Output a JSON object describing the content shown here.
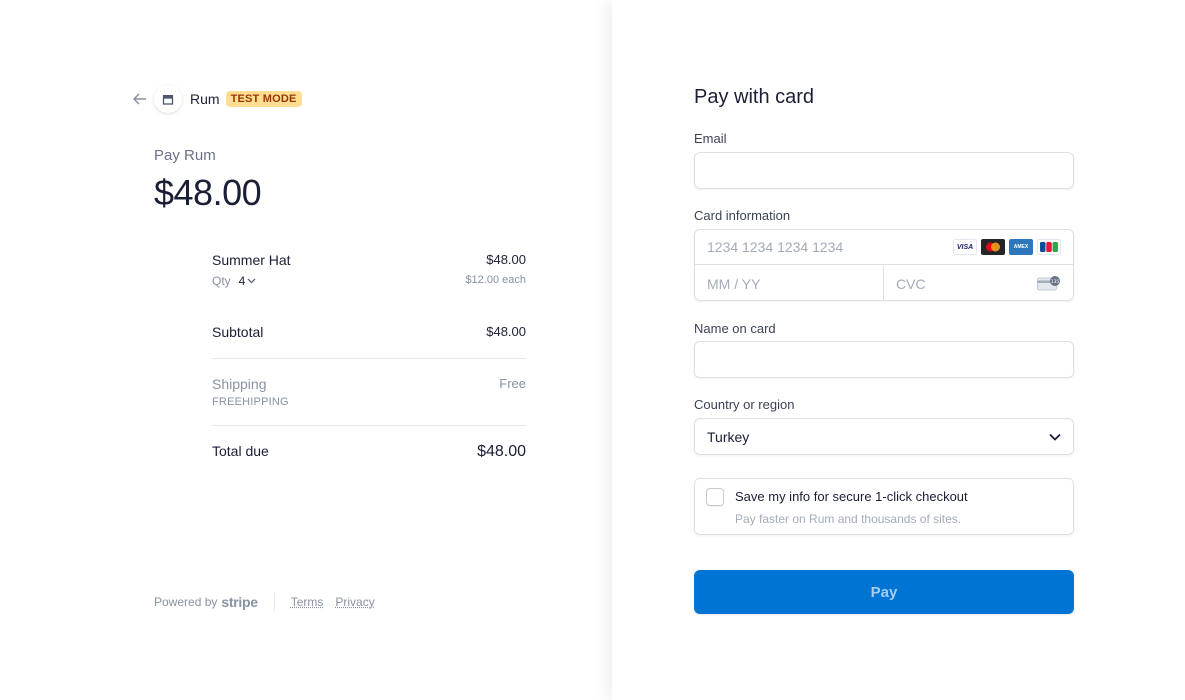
{
  "merchant": {
    "name": "Rum",
    "badge": "TEST MODE",
    "pay_label": "Pay Rum",
    "amount": "$48.00"
  },
  "line_item": {
    "name": "Summer Hat",
    "price": "$48.00",
    "qty_label": "Qty",
    "qty_value": "4",
    "unit_price": "$12.00 each"
  },
  "subtotal": {
    "label": "Subtotal",
    "value": "$48.00"
  },
  "shipping": {
    "label": "Shipping",
    "code": "FREEHIPPING",
    "value": "Free"
  },
  "total": {
    "label": "Total due",
    "value": "$48.00"
  },
  "footer": {
    "powered_by": "Powered by",
    "brand": "stripe",
    "terms": "Terms",
    "privacy": "Privacy"
  },
  "form": {
    "title": "Pay with card",
    "email_label": "Email",
    "email_value": "",
    "card_label": "Card information",
    "card_number_placeholder": "1234 1234 1234 1234",
    "expiry_placeholder": "MM / YY",
    "cvc_placeholder": "CVC",
    "card_brands": [
      "VISA",
      "MC",
      "AMEX",
      "JCB"
    ],
    "name_label": "Name on card",
    "name_value": "",
    "country_label": "Country or region",
    "country_value": "Turkey",
    "save_title": "Save my info for secure 1-click checkout",
    "save_subtitle": "Pay faster on Rum and thousands of sites.",
    "save_checked": false,
    "pay_button": "Pay"
  },
  "colors": {
    "accent": "#0074d4",
    "badge_bg": "#ffde92",
    "badge_text": "#983705"
  }
}
